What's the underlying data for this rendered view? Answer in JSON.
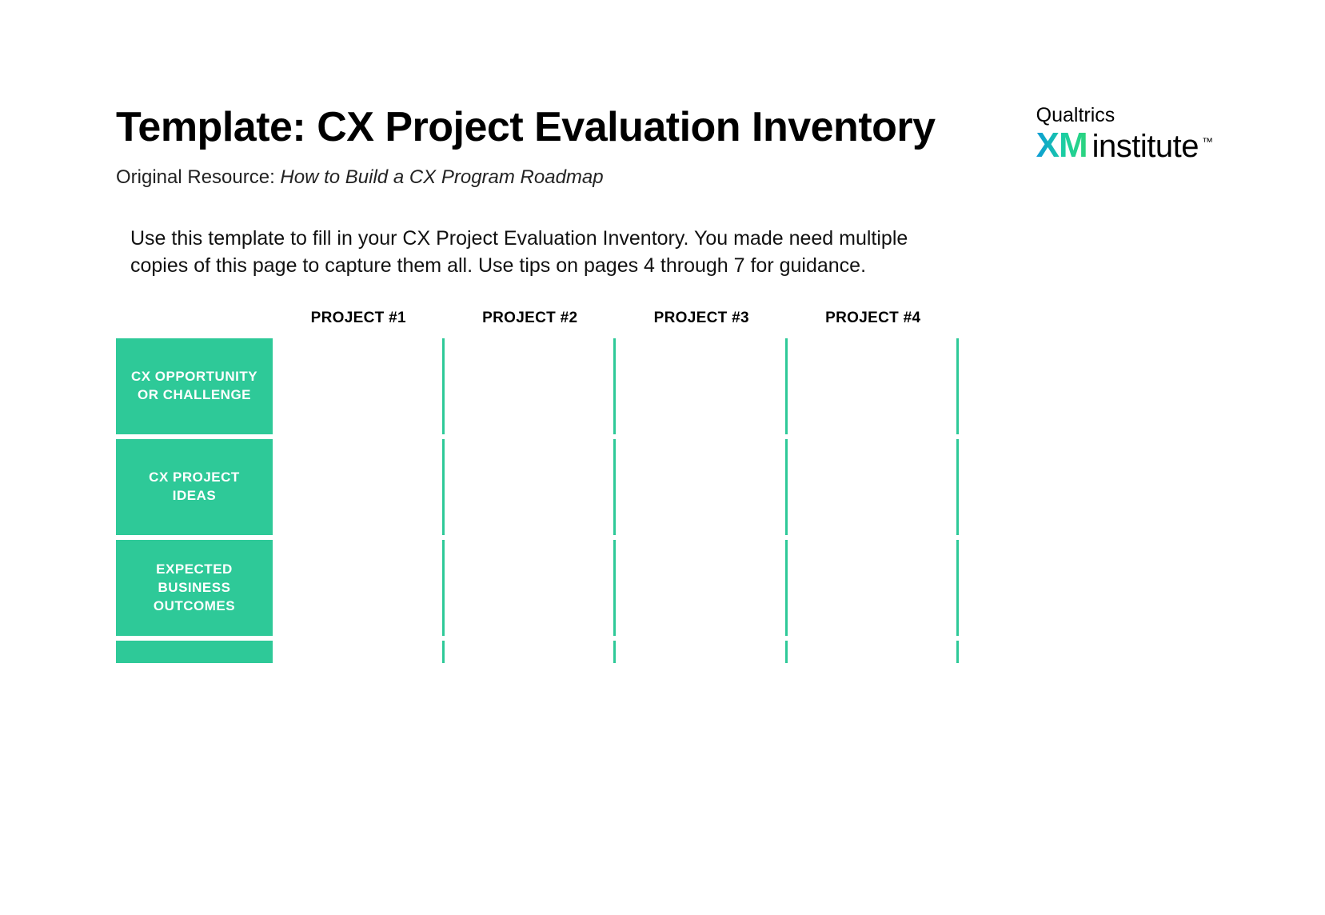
{
  "header": {
    "title": "Template: CX Project Evaluation Inventory",
    "subtitle_label": "Original Resource: ",
    "subtitle_resource": "How to Build a CX Program Roadmap"
  },
  "logo": {
    "brand": "Qualtrics",
    "xm": "XM",
    "institute": "institute",
    "tm": "™"
  },
  "intro": "Use this template to fill in your CX Project Evaluation Inventory. You made need multiple copies of this page to capture them all. Use tips on pages 4 through 7 for guidance.",
  "table": {
    "columns": [
      "PROJECT #1",
      "PROJECT #2",
      "PROJECT #3",
      "PROJECT #4"
    ],
    "rows": [
      "CX OPPORTUNITY OR CHALLENGE",
      "CX PROJECT IDEAS",
      "EXPECTED BUSINESS OUTCOMES"
    ]
  }
}
